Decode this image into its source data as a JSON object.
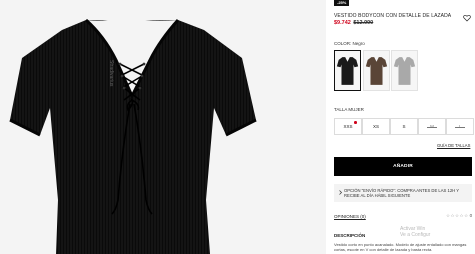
{
  "product": {
    "discount_badge": "-25%",
    "title": "VESTIDO BODYCON CON DETALLE DE LAZADA",
    "price_new": "$9.742",
    "price_old": "$12.990"
  },
  "color": {
    "label": "COLOR:",
    "selected": "Negro",
    "swatches": [
      {
        "name": "Negro",
        "hex": "#1a1a1a"
      },
      {
        "name": "Marrón",
        "hex": "#5a4537"
      },
      {
        "name": "Gris",
        "hex": "#a9a9a9"
      }
    ]
  },
  "size": {
    "label": "TALLA MUJER",
    "options": [
      {
        "label": "XXS",
        "available": true,
        "dot": true
      },
      {
        "label": "XS",
        "available": true,
        "dot": false
      },
      {
        "label": "S",
        "available": true,
        "dot": false
      },
      {
        "label": "M",
        "available": false,
        "dot": false
      },
      {
        "label": "L",
        "available": false,
        "dot": false
      }
    ],
    "guide_label": "GUÍA DE TALLAS"
  },
  "cart": {
    "add_label": "AÑADIR"
  },
  "notice": {
    "text": "OPCIÓN \"ENVÍO RÁPIDO\": COMPRA ANTES DE LAS 12H Y RECIBE AL DÍA HÁBIL SIGUIENTE"
  },
  "reviews": {
    "label": "OPINIONES (0)",
    "count": "0",
    "rating": 0
  },
  "description": {
    "title": "DESCRIPCIÓN",
    "text": "Vestido corto en punto acanalado. Modelo de ajuste entallado con mangas cortas, escote en V con detalle de lazada y basta recta."
  },
  "watermark": {
    "line1": "Activar Win",
    "line2": "Ve a Configur"
  },
  "colors": {
    "sale_red": "#d0021b",
    "button_black": "#000000"
  }
}
